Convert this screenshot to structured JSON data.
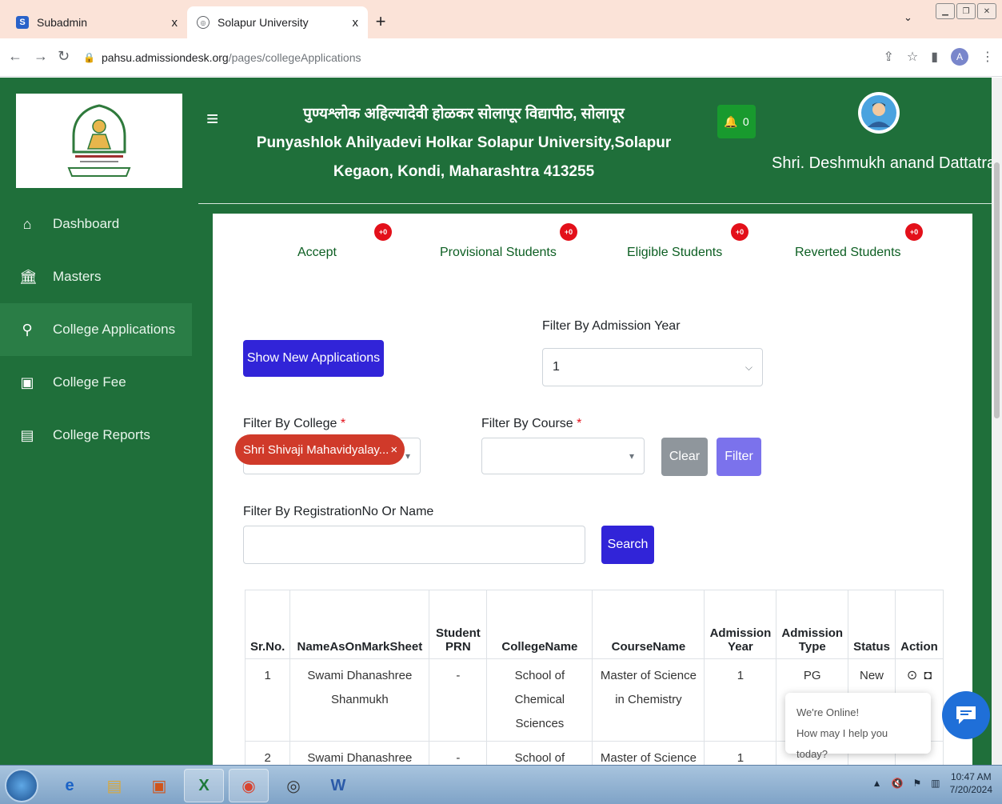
{
  "browser": {
    "tabs": [
      {
        "title": "Subadmin",
        "close": "x"
      },
      {
        "title": "Solapur University",
        "close": "x"
      }
    ],
    "new_tab": "+",
    "url_host": "pahsu.admissiondesk.org",
    "url_path": "/pages/collegeApplications",
    "profile_initial": "A"
  },
  "header": {
    "title_marathi": "पुण्यश्लोक अहिल्यादेवी होळकर सोलापूर विद्यापीठ, सोलापूर",
    "title_english": "Punyashlok Ahilyadevi Holkar Solapur University,Solapur",
    "address": "Kegaon, Kondi, Maharashtra 413255",
    "notification_count": "0",
    "user_name": "Shri. Deshmukh anand Dattatray"
  },
  "sidebar": {
    "items": [
      {
        "label": "Dashboard",
        "icon": "home-icon",
        "glyph": "⌂"
      },
      {
        "label": "Masters",
        "icon": "bank-icon",
        "glyph": "🏛"
      },
      {
        "label": "College Applications",
        "icon": "person-icon",
        "glyph": "⚲"
      },
      {
        "label": "College Fee",
        "icon": "money-icon",
        "glyph": "▣"
      },
      {
        "label": "College Reports",
        "icon": "report-icon",
        "glyph": "▤"
      }
    ]
  },
  "stats": [
    {
      "label": "Accept",
      "badge": "+0"
    },
    {
      "label": "Provisional Students",
      "badge": "+0"
    },
    {
      "label": "Eligible Students",
      "badge": "+0"
    },
    {
      "label": "Reverted Students",
      "badge": "+0"
    }
  ],
  "filters": {
    "show_new_button": "Show New Applications",
    "admission_year_label": "Filter By Admission Year",
    "admission_year_value": "1",
    "college_label": "Filter By College",
    "college_value": "Shri Shivaji Mahavidyalay...",
    "college_clear": "×",
    "course_label": "Filter By Course",
    "required_mark": "*",
    "clear_button": "Clear",
    "filter_button": "Filter",
    "search_label": "Filter By RegistrationNo Or Name",
    "search_button": "Search"
  },
  "table": {
    "headers": [
      "Sr.No.",
      "NameAsOnMarkSheet",
      "Student PRN",
      "CollegeName",
      "CourseName",
      "Admission Year",
      "Admission Type",
      "Status",
      "Action"
    ],
    "rows": [
      {
        "sr": "1",
        "name": "Swami Dhanashree Shanmukh",
        "prn": "-",
        "college": "School of Chemical Sciences",
        "course": "Master of Science in Chemistry",
        "year": "1",
        "type": "PG",
        "status": "New"
      },
      {
        "sr": "2",
        "name": "Swami Dhanashree",
        "prn": "-",
        "college": "School of",
        "course": "Master of Science",
        "year": "1",
        "type": "",
        "status": ""
      }
    ]
  },
  "chat": {
    "line1": "We're Online!",
    "line2": "How may I help you today?"
  },
  "taskbar": {
    "time": "10:47 AM",
    "date": "7/20/2024"
  }
}
